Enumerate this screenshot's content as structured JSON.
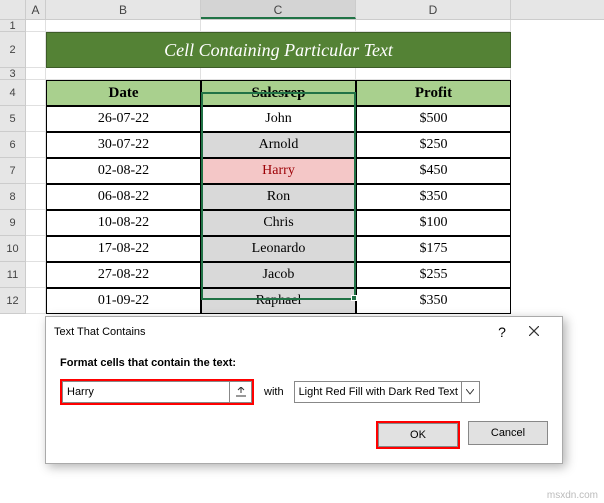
{
  "columns": [
    "A",
    "B",
    "C",
    "D"
  ],
  "rows": [
    "1",
    "2",
    "3",
    "4",
    "5",
    "6",
    "7",
    "8",
    "9",
    "10",
    "11",
    "12"
  ],
  "title": "Cell Containing Particular Text",
  "headers": {
    "date": "Date",
    "salesrep": "Salesrep",
    "profit": "Profit"
  },
  "data": [
    {
      "date": "26-07-22",
      "rep": "John",
      "profit": "$500"
    },
    {
      "date": "30-07-22",
      "rep": "Arnold",
      "profit": "$250"
    },
    {
      "date": "02-08-22",
      "rep": "Harry",
      "profit": "$450"
    },
    {
      "date": "06-08-22",
      "rep": "Ron",
      "profit": "$350"
    },
    {
      "date": "10-08-22",
      "rep": "Chris",
      "profit": "$100"
    },
    {
      "date": "17-08-22",
      "rep": "Leonardo",
      "profit": "$175"
    },
    {
      "date": "27-08-22",
      "rep": "Jacob",
      "profit": "$255"
    },
    {
      "date": "01-09-22",
      "rep": "Raphael",
      "profit": "$350"
    }
  ],
  "dialog": {
    "title": "Text That Contains",
    "help": "?",
    "label": "Format cells that contain the text:",
    "text_value": "Harry",
    "with": "with",
    "format_option": "Light Red Fill with Dark Red Text",
    "ok": "OK",
    "cancel": "Cancel"
  },
  "watermark": "msxdn.com",
  "chart_data": {
    "type": "table",
    "columns": [
      "Date",
      "Salesrep",
      "Profit"
    ],
    "rows": [
      [
        "26-07-22",
        "John",
        "$500"
      ],
      [
        "30-07-22",
        "Arnold",
        "$250"
      ],
      [
        "02-08-22",
        "Harry",
        "$450"
      ],
      [
        "06-08-22",
        "Ron",
        "$350"
      ],
      [
        "10-08-22",
        "Chris",
        "$100"
      ],
      [
        "17-08-22",
        "Leonardo",
        "$175"
      ],
      [
        "27-08-22",
        "Jacob",
        "$255"
      ],
      [
        "01-09-22",
        "Raphael",
        "$350"
      ]
    ]
  }
}
